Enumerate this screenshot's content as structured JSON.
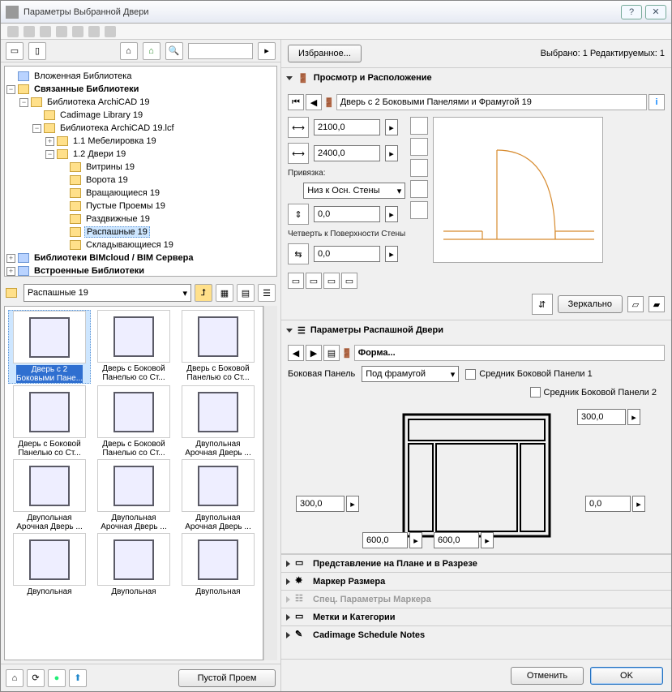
{
  "window": {
    "title": "Параметры Выбранной Двери"
  },
  "toprow": {
    "favorites": "Избранное...",
    "status": "Выбрано: 1 Редактируемых: 1"
  },
  "tree": {
    "root1": "Вложенная Библиотека",
    "root2": "Связанные Библиотеки",
    "ac19": "Библиотека ArchiCAD 19",
    "cadimage": "Cadimage Library 19",
    "ac19lcf": "Библиотека ArchiCAD 19.lcf",
    "furn": "1.1 Мебелировка 19",
    "doors": "1.2 Двери 19",
    "d1": "Витрины 19",
    "d2": "Ворота 19",
    "d3": "Вращающиеся 19",
    "d4": "Пустые Проемы 19",
    "d5": "Раздвижные 19",
    "d6": "Распашные 19",
    "d7": "Складывающиеся 19",
    "bim": "Библиотеки BIMcloud / BIM Сервера",
    "emb": "Встроенные Библиотеки"
  },
  "libcombo": "Распашные 19",
  "cards": [
    {
      "l1": "Дверь с 2",
      "l2": "Боковыми Пане..."
    },
    {
      "l1": "Дверь с Боковой",
      "l2": "Панелью со Ст..."
    },
    {
      "l1": "Дверь с Боковой",
      "l2": "Панелью со Ст..."
    },
    {
      "l1": "Дверь с Боковой",
      "l2": "Панелью со Ст..."
    },
    {
      "l1": "Дверь с Боковой",
      "l2": "Панелью со Ст..."
    },
    {
      "l1": "Двупольная",
      "l2": "Арочная Дверь ..."
    },
    {
      "l1": "Двупольная",
      "l2": "Арочная Дверь ..."
    },
    {
      "l1": "Двупольная",
      "l2": "Арочная Дверь ..."
    },
    {
      "l1": "Двупольная",
      "l2": "Арочная Дверь ..."
    },
    {
      "l1": "Двупольная",
      "l2": ""
    },
    {
      "l1": "Двупольная",
      "l2": ""
    },
    {
      "l1": "Двупольная",
      "l2": ""
    }
  ],
  "leftfooter": {
    "empty": "Пустой Проем"
  },
  "sections": {
    "preview": "Просмотр и Расположение",
    "params": "Параметры Распашной Двери",
    "plan": "Представление на Плане и в Разрезе",
    "marker": "Маркер Размера",
    "special": "Спец. Параметры Маркера",
    "tags": "Метки и Категории",
    "cadimage": "Cadimage Schedule Notes"
  },
  "preview": {
    "name": "Дверь с 2 Боковыми Панелями и Фрамугой 19",
    "width": "2100,0",
    "height": "2400,0",
    "anchor_lbl": "Привязка:",
    "anchor_combo": "Низ к Осн. Стены",
    "anchor_val": "0,0",
    "reveal_lbl": "Четверть к Поверхности Стены",
    "reveal_val": "0,0",
    "mirror": "Зеркально"
  },
  "params": {
    "shape": "Форма...",
    "side_label": "Боковая Панель",
    "side_combo": "Под фрамугой",
    "chk1": "Средник Боковой Панели 1",
    "chk2": "Средник Боковой Панели 2",
    "v_top": "300,0",
    "v_left": "300,0",
    "v_right": "0,0",
    "v_bl": "600,0",
    "v_br": "600,0"
  },
  "footer": {
    "cancel": "Отменить",
    "ok": "OK"
  }
}
